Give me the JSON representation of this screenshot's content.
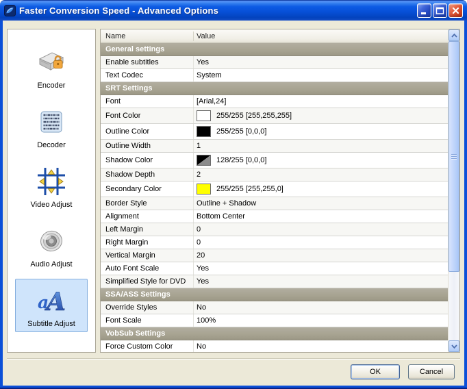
{
  "window": {
    "title": "Faster Conversion Speed - Advanced Options",
    "controls": {
      "minimize": "minimize",
      "maximize": "maximize",
      "close": "close"
    }
  },
  "sidebar": {
    "items": [
      {
        "id": "encoder",
        "label": "Encoder",
        "icon": "encoder-icon",
        "selected": false
      },
      {
        "id": "decoder",
        "label": "Decoder",
        "icon": "decoder-icon",
        "selected": false
      },
      {
        "id": "video-adjust",
        "label": "Video Adjust",
        "icon": "video-adjust-icon",
        "selected": false
      },
      {
        "id": "audio-adjust",
        "label": "Audio Adjust",
        "icon": "audio-adjust-icon",
        "selected": false
      },
      {
        "id": "subtitle-adjust",
        "label": "Subtitle Adjust",
        "icon": "subtitle-adjust-icon",
        "selected": true
      }
    ]
  },
  "table": {
    "columns": [
      "Name",
      "Value"
    ],
    "rows": [
      {
        "type": "section",
        "name": "General settings"
      },
      {
        "type": "row",
        "name": "Enable subtitles",
        "value": "Yes",
        "shade": true
      },
      {
        "type": "row",
        "name": "Text Codec",
        "value": "System",
        "shade": false
      },
      {
        "type": "section",
        "name": "SRT Settings"
      },
      {
        "type": "row",
        "name": "Font",
        "value": "[Arial,24]",
        "shade": false
      },
      {
        "type": "color",
        "name": "Font Color",
        "value": "255/255 [255,255,255]",
        "swatch": "#ffffff",
        "shade": true
      },
      {
        "type": "color",
        "name": "Outline Color",
        "value": "255/255 [0,0,0]",
        "swatch": "#000000",
        "shade": false
      },
      {
        "type": "row",
        "name": "Outline Width",
        "value": "1",
        "shade": true
      },
      {
        "type": "color",
        "name": "Shadow Color",
        "value": "128/255 [0,0,0]",
        "swatch": "split",
        "shade": false
      },
      {
        "type": "row",
        "name": "Shadow Depth",
        "value": "2",
        "shade": true
      },
      {
        "type": "color",
        "name": "Secondary Color",
        "value": "255/255 [255,255,0]",
        "swatch": "#ffff00",
        "shade": false
      },
      {
        "type": "row",
        "name": "Border Style",
        "value": "Outline + Shadow",
        "shade": true
      },
      {
        "type": "row",
        "name": "Alignment",
        "value": "Bottom Center",
        "shade": false
      },
      {
        "type": "row",
        "name": "Left Margin",
        "value": "0",
        "shade": true
      },
      {
        "type": "row",
        "name": "Right Margin",
        "value": "0",
        "shade": false
      },
      {
        "type": "row",
        "name": "Vertical Margin",
        "value": "20",
        "shade": true
      },
      {
        "type": "row",
        "name": "Auto Font Scale",
        "value": "Yes",
        "shade": false
      },
      {
        "type": "row",
        "name": "Simplified Style for DVD",
        "value": "Yes",
        "shade": true
      },
      {
        "type": "section",
        "name": "SSA/ASS Settings"
      },
      {
        "type": "row",
        "name": "Override Styles",
        "value": "No",
        "shade": true
      },
      {
        "type": "row",
        "name": "Font Scale",
        "value": "100%",
        "shade": false
      },
      {
        "type": "section",
        "name": "VobSub Settings"
      },
      {
        "type": "row",
        "name": "Force Custom Color",
        "value": "No",
        "shade": false
      }
    ]
  },
  "footer": {
    "ok_label": "OK",
    "cancel_label": "Cancel"
  },
  "colors": {
    "titlebar_blue": "#0c50d8",
    "dialog_bg": "#ece9d8",
    "section_header_bg": "#a8a492",
    "selected_item_bg": "#cfe4fb",
    "selected_item_border": "#84aede"
  }
}
